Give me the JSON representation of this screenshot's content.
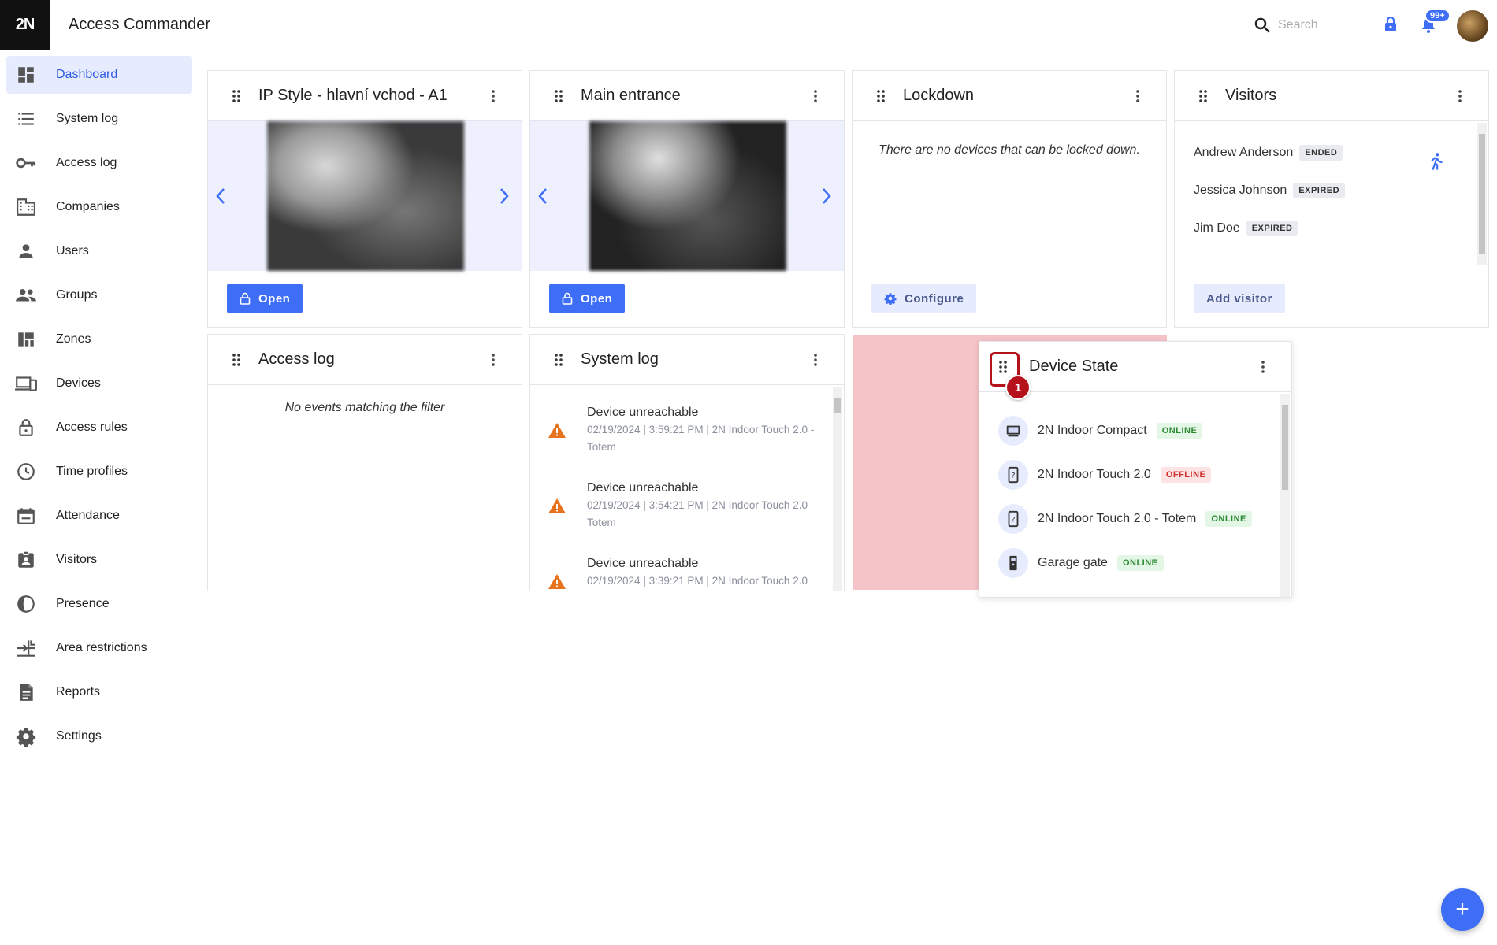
{
  "header": {
    "logo_text": "2N",
    "app_title": "Access Commander",
    "search_placeholder": "Search",
    "notification_count": "99+"
  },
  "sidebar": {
    "items": [
      {
        "label": "Dashboard",
        "icon": "dashboard-icon",
        "active": true
      },
      {
        "label": "System log",
        "icon": "list-icon"
      },
      {
        "label": "Access log",
        "icon": "key-icon"
      },
      {
        "label": "Companies",
        "icon": "building-icon"
      },
      {
        "label": "Users",
        "icon": "user-icon"
      },
      {
        "label": "Groups",
        "icon": "group-icon"
      },
      {
        "label": "Zones",
        "icon": "zones-icon"
      },
      {
        "label": "Devices",
        "icon": "devices-icon"
      },
      {
        "label": "Access rules",
        "icon": "lock-icon"
      },
      {
        "label": "Time profiles",
        "icon": "clock-icon"
      },
      {
        "label": "Attendance",
        "icon": "calendar-icon"
      },
      {
        "label": "Visitors",
        "icon": "visitor-badge-icon"
      },
      {
        "label": "Presence",
        "icon": "presence-icon"
      },
      {
        "label": "Area restrictions",
        "icon": "area-icon"
      },
      {
        "label": "Reports",
        "icon": "report-icon"
      },
      {
        "label": "Settings",
        "icon": "gear-icon"
      }
    ]
  },
  "cards": {
    "camera1": {
      "title": "IP Style - hlavní vchod - A1",
      "button": "Open"
    },
    "camera2": {
      "title": "Main entrance",
      "button": "Open"
    },
    "lockdown": {
      "title": "Lockdown",
      "message": "There are no devices that can be locked down.",
      "button": "Configure"
    },
    "visitors": {
      "title": "Visitors",
      "rows": [
        {
          "name": "Andrew Anderson",
          "status": "ENDED"
        },
        {
          "name": "Jessica Johnson",
          "status": "EXPIRED"
        },
        {
          "name": "Jim Doe",
          "status": "EXPIRED"
        }
      ],
      "button": "Add visitor"
    },
    "access_log": {
      "title": "Access log",
      "message": "No events matching the filter"
    },
    "system_log": {
      "title": "System log",
      "entries": [
        {
          "title": "Device unreachable",
          "meta": "02/19/2024 | 3:59:21 PM | 2N Indoor Touch 2.0 - Totem"
        },
        {
          "title": "Device unreachable",
          "meta": "02/19/2024 | 3:54:21 PM | 2N Indoor Touch 2.0 - Totem"
        },
        {
          "title": "Device unreachable",
          "meta": "02/19/2024 | 3:39:21 PM | 2N Indoor Touch 2.0"
        }
      ]
    },
    "device_state": {
      "title": "Device State",
      "devices": [
        {
          "name": "2N Indoor Compact",
          "status": "ONLINE"
        },
        {
          "name": "2N Indoor Touch 2.0",
          "status": "OFFLINE"
        },
        {
          "name": "2N Indoor Touch 2.0 - Totem",
          "status": "ONLINE"
        },
        {
          "name": "Garage gate",
          "status": "ONLINE"
        }
      ]
    }
  },
  "step_badge": "1",
  "fab_label": "+",
  "colors": {
    "accent": "#3d6ef5",
    "highlight": "#b5121b",
    "drop_zone": "#f5c4c8"
  }
}
